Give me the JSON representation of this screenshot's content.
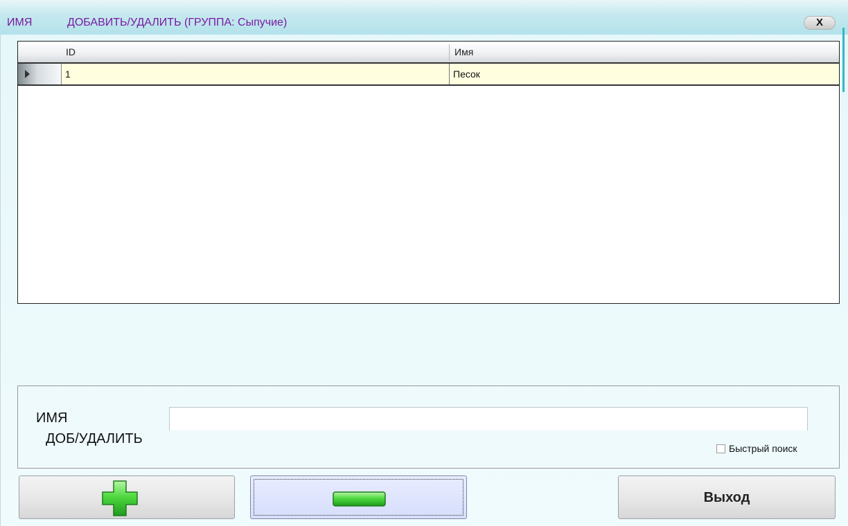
{
  "window": {
    "title_left": "ИМЯ",
    "title_right": "ДОБАВИТЬ/УДАЛИТЬ (ГРУППА: Сыпучие)",
    "close_label": "X"
  },
  "grid": {
    "columns": [
      "ID",
      "Имя"
    ],
    "rows": [
      {
        "id": "1",
        "name": "Песок",
        "selected": true
      }
    ],
    "selected_row_color": "#ffffe0"
  },
  "form": {
    "name_label": "ИМЯ",
    "adddel_label": "ДОБ/УДАЛИТЬ",
    "name_value": "",
    "quick_search_label": "Быстрый поиск",
    "quick_search_checked": false
  },
  "buttons": {
    "add_icon": "plus-icon",
    "remove_icon": "minus-icon",
    "exit_label": "Выход"
  },
  "colors": {
    "title_text": "#7a1aa2",
    "accent_green": "#2ecc2e"
  }
}
